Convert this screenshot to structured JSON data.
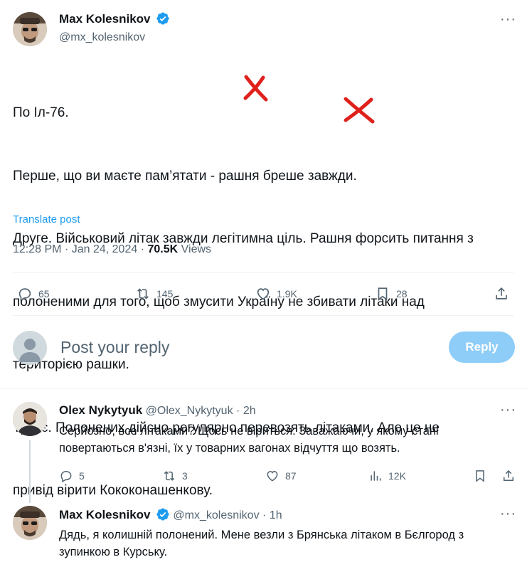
{
  "main_tweet": {
    "author_name": "Max Kolesnikov",
    "author_handle": "@mx_kolesnikov",
    "lines": [
      "По Іл-76.",
      "Перше, що ви маєте пам’ятати - рашня бреше завжди.",
      "Друге. Військовий літак завжди легітимна ціль. Рашня форсить питання з",
      "полоненими для того, щоб змусити Україну не збивати літаки над",
      "територією рашки.",
      "Третє. Полонених дійсно регулярно перевозять літаками. Але це не",
      "привід вірити Кококонашенкову."
    ],
    "translate_label": "Translate post",
    "time": "12:28 PM",
    "date": "Jan 24, 2024",
    "views_count": "70.5K",
    "views_label": "Views",
    "replies": "65",
    "reposts": "145",
    "likes": "1.9K",
    "bookmarks": "28"
  },
  "composer": {
    "placeholder": "Post your reply",
    "button_label": "Reply"
  },
  "replies": [
    {
      "author_name": "Olex Nykytyuk",
      "author_handle": "@Olex_Nykytyuk",
      "time": "2h",
      "lines": [
        "Серйозно, все літаками? Щось не віриться. Заважаючи, у якому стані",
        "повертаються в'язні, їх у товарних вагонах відчуття що возять."
      ],
      "replies": "5",
      "reposts": "3",
      "likes": "87",
      "views": "12K"
    },
    {
      "author_name": "Max Kolesnikov",
      "author_handle": "@mx_kolesnikov",
      "time": "1h",
      "lines": [
        "Дядь, я колишній полонений. Мене везли з Брянська літаком в Бєлгород з",
        "зупинкою в Курську."
      ]
    }
  ],
  "separator": "·",
  "colors": {
    "accent": "#1d9bf0",
    "reply_button": "#8ecdf8",
    "text": "#0f1419",
    "muted": "#536471",
    "strike": "#e0201b"
  }
}
